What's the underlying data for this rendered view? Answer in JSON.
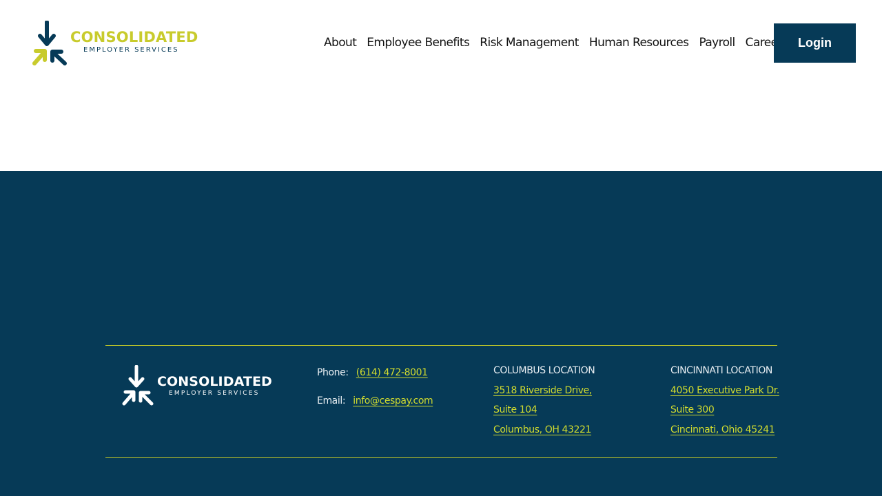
{
  "brand": {
    "name_line1": "CONSOLIDATED",
    "name_line2": "EMPLOYER SERVICES",
    "colors": {
      "navy": "#063a57",
      "lime": "#c8cb2c",
      "white": "#ffffff"
    }
  },
  "nav": {
    "items": [
      {
        "label": "About"
      },
      {
        "label": "Employee Benefits"
      },
      {
        "label": "Risk Management"
      },
      {
        "label": "Human Resources"
      },
      {
        "label": "Payroll"
      },
      {
        "label": "Careers"
      }
    ],
    "login_label": "Login"
  },
  "footer": {
    "phone_label": "Phone:",
    "phone_value": "(614) 472-8001",
    "email_label": "Email:",
    "email_value": "info@cespay.com",
    "locations": [
      {
        "title": "COLUMBUS LOCATION",
        "lines": [
          "3518 Riverside Drive,",
          "Suite 104",
          "Columbus, OH 43221"
        ]
      },
      {
        "title": "CINCINNATI LOCATION",
        "lines": [
          "4050 Executive Park Dr.",
          "Suite 300",
          "Cincinnati, Ohio 45241"
        ]
      }
    ]
  }
}
